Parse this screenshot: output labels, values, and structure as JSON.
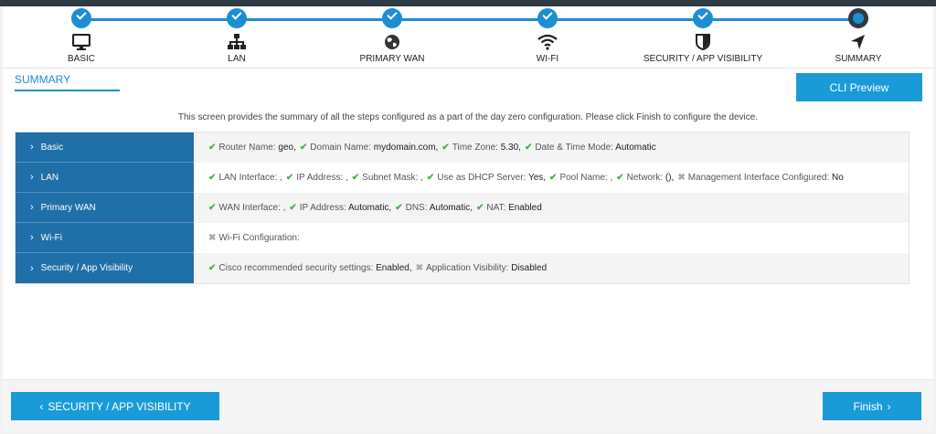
{
  "stepper": {
    "steps": [
      {
        "label": "BASIC",
        "icon": "monitor-icon",
        "status": "complete"
      },
      {
        "label": "LAN",
        "icon": "network-icon",
        "status": "complete"
      },
      {
        "label": "PRIMARY WAN",
        "icon": "globe-icon",
        "status": "complete"
      },
      {
        "label": "WI-FI",
        "icon": "wifi-icon",
        "status": "complete"
      },
      {
        "label": "SECURITY / APP VISIBILITY",
        "icon": "shield-icon",
        "status": "complete"
      },
      {
        "label": "SUMMARY",
        "icon": "navigation-arrow-icon",
        "status": "current"
      }
    ]
  },
  "header": {
    "title": "SUMMARY",
    "cli_preview_label": "CLI Preview"
  },
  "intro_text": "This screen provides the summary of all the steps configured as a part of the day zero configuration. Please click Finish to configure the device.",
  "summary_rows": [
    {
      "title": "Basic",
      "items": [
        {
          "ok": true,
          "label": "Router Name:",
          "value": "geo,"
        },
        {
          "ok": true,
          "label": "Domain Name:",
          "value": "mydomain.com,"
        },
        {
          "ok": true,
          "label": "Time Zone:",
          "value": "5.30,"
        },
        {
          "ok": true,
          "label": "Date & Time Mode:",
          "value": "Automatic"
        }
      ]
    },
    {
      "title": "LAN",
      "items": [
        {
          "ok": true,
          "label": "LAN Interface: ,",
          "value": ""
        },
        {
          "ok": true,
          "label": "IP Address: ,",
          "value": ""
        },
        {
          "ok": true,
          "label": "Subnet Mask: ,",
          "value": ""
        },
        {
          "ok": true,
          "label": "Use as DHCP Server:",
          "value": "Yes,"
        },
        {
          "ok": true,
          "label": "Pool Name: ,",
          "value": ""
        },
        {
          "ok": true,
          "label": "Network:",
          "value": "(),"
        },
        {
          "ok": false,
          "label": "Management Interface Configured:",
          "value": "No"
        }
      ]
    },
    {
      "title": "Primary WAN",
      "items": [
        {
          "ok": true,
          "label": "WAN Interface: ,",
          "value": ""
        },
        {
          "ok": true,
          "label": "IP Address:",
          "value": "Automatic,"
        },
        {
          "ok": true,
          "label": "DNS:",
          "value": "Automatic,"
        },
        {
          "ok": true,
          "label": "NAT:",
          "value": "Enabled"
        }
      ]
    },
    {
      "title": "Wi-Fi",
      "items": [
        {
          "ok": false,
          "label": "Wi-Fi Configuration:",
          "value": ""
        }
      ]
    },
    {
      "title": "Security / App Visibility",
      "items": [
        {
          "ok": true,
          "label": "Cisco recommended security settings:",
          "value": "Enabled,"
        },
        {
          "ok": false,
          "label": "Application Visibility:",
          "value": "Disabled"
        }
      ]
    }
  ],
  "footer": {
    "back_label": "SECURITY / APP VISIBILITY",
    "back_chevron": "‹",
    "finish_label": "Finish",
    "finish_chevron": "›"
  },
  "colors": {
    "accent": "#1a9bd7",
    "row_header": "#1f6fa8",
    "success": "#4cae4c",
    "inactive": "#aaaaaa"
  }
}
